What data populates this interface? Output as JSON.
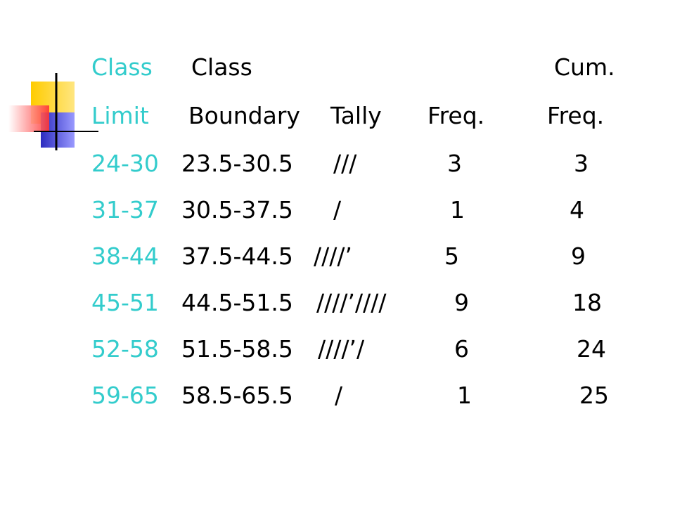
{
  "header": {
    "row1": {
      "limit": "Class",
      "boundary": "Class",
      "cum": "Cum."
    },
    "row2": {
      "limit": "Limit",
      "boundary": "Boundary",
      "tally": "Tally",
      "freq": "Freq.",
      "cum": "Freq."
    }
  },
  "rows": [
    {
      "limit": "24-30",
      "boundary": "23.5-30.5",
      "tally": "///",
      "freq": "3",
      "cum": "3"
    },
    {
      "limit": "31-37",
      "boundary": "30.5-37.5",
      "tally": "/",
      "freq": "1",
      "cum": "4"
    },
    {
      "limit": "38-44",
      "boundary": "37.5-44.5",
      "tally": "////’",
      "freq": "5",
      "cum": "9"
    },
    {
      "limit": "45-51",
      "boundary": "44.5-51.5",
      "tally": "////’////",
      "freq": "9",
      "cum": "18"
    },
    {
      "limit": "52-58",
      "boundary": "51.5-58.5",
      "tally": "////’/",
      "freq": "6",
      "cum": "24"
    },
    {
      "limit": "59-65",
      "boundary": "58.5-65.5",
      "tally": "/",
      "freq": "1",
      "cum": "25"
    }
  ],
  "colors": {
    "limit_text": "#33cccc",
    "body_text": "#000000",
    "deco_yellow": "#ffcc00",
    "deco_blue": "#3333cc",
    "deco_red": "#ff3333"
  }
}
